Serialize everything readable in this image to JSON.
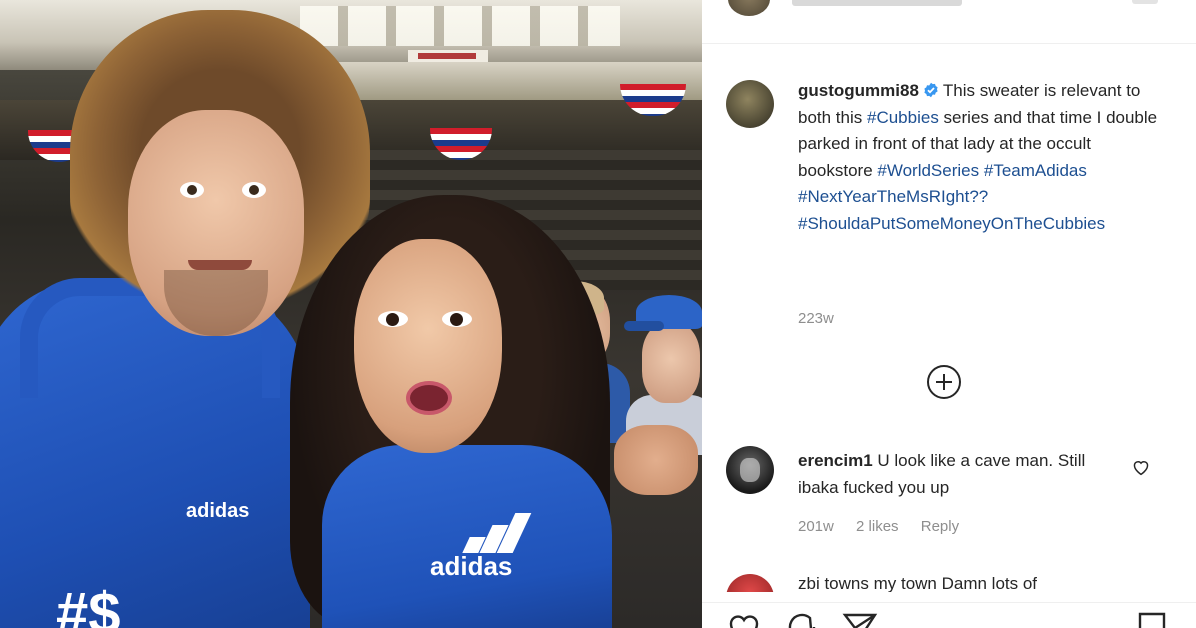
{
  "photo": {
    "hoodie_logo_left": "adidas",
    "hoodie_brand": "adidas",
    "hoodie_text": "#$"
  },
  "post": {
    "username": "gustogummi88",
    "caption_text": "This sweater is relevant to both this ",
    "tag_cubbies": "#Cubbies",
    "caption_text_2": " series and that time I double parked in front of that lady at the occult bookstore ",
    "tag_worldseries": "#WorldSeries",
    "tag_teamadidas": "#TeamAdidas",
    "tag_nextyear": "#NextYearTheMsRIght??",
    "tag_shoulda": "#ShouldaPutSomeMoneyOnTheCubbies",
    "age": "223w"
  },
  "comment": {
    "username": "erencim1",
    "text": "U look like a cave man. Still ibaka fucked you up",
    "age": "201w",
    "likes": "2 likes",
    "reply": "Reply"
  },
  "next_comment": {
    "text_partial": "zbi towns my town Damn lots of"
  },
  "icons": {
    "verified": "verified-badge-icon",
    "load_more": "plus-circle-icon",
    "like": "heart-icon",
    "comment": "comment-icon",
    "share": "paper-plane-icon",
    "save": "bookmark-icon"
  },
  "colors": {
    "hashtag": "#1d4f91",
    "verified": "#3897f0",
    "muted": "#8e8e8e",
    "hoodie_blue": "#2f67d1"
  }
}
